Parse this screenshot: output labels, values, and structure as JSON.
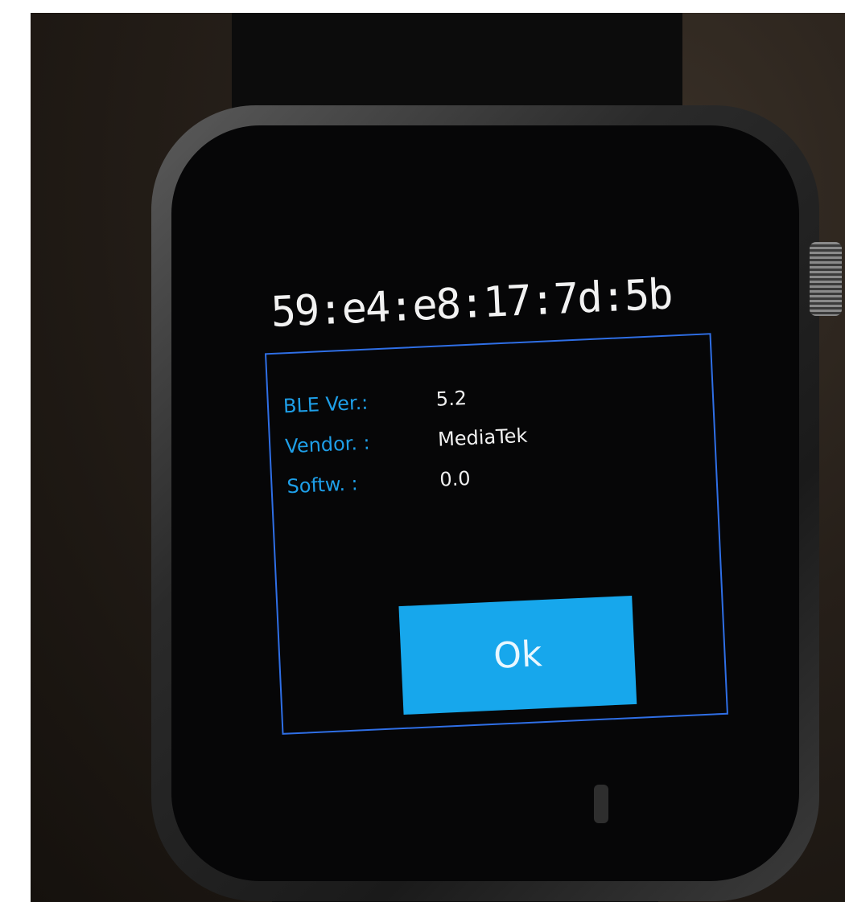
{
  "device": {
    "mac_address": "59:e4:e8:17:7d:5b"
  },
  "info": {
    "rows": [
      {
        "label": "BLE Ver.:",
        "value": "5.2"
      },
      {
        "label": "Vendor. :",
        "value": "MediaTek"
      },
      {
        "label": "Softw. :",
        "value": "0.0"
      }
    ]
  },
  "actions": {
    "ok_label": "Ok"
  },
  "colors": {
    "label_blue": "#1e9fe8",
    "panel_border": "#2f6fe6",
    "button_bg": "#17a7ec",
    "screen_bg": "#060607"
  }
}
